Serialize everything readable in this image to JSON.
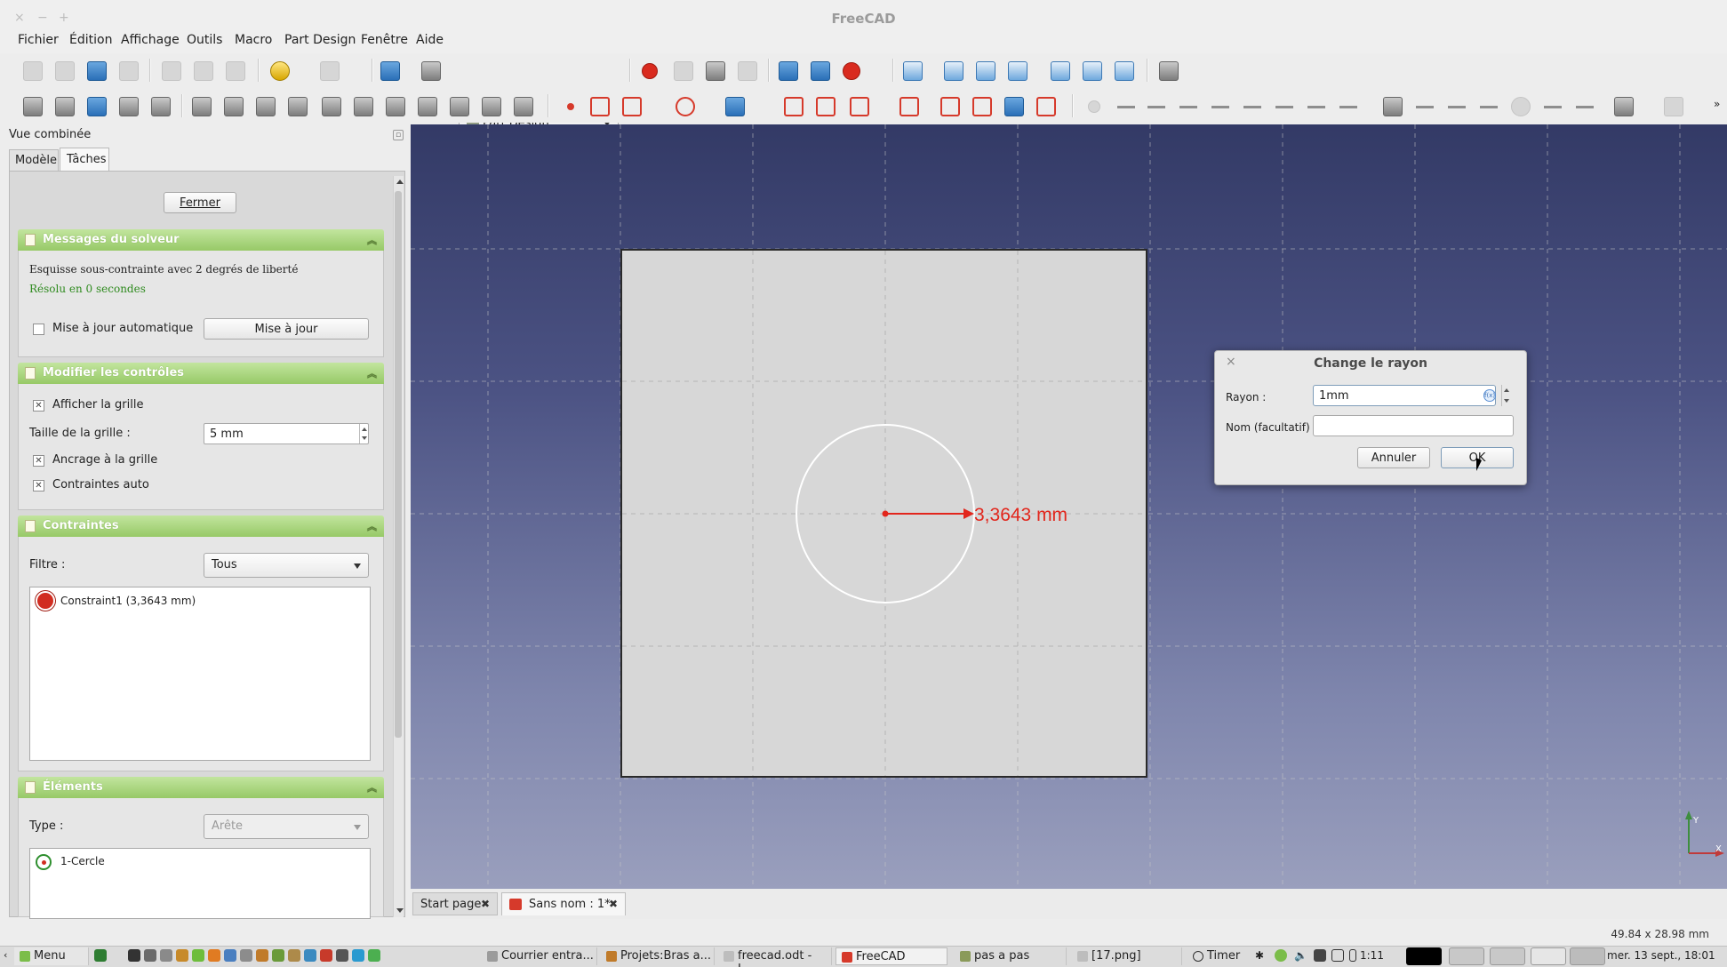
{
  "window": {
    "title": "FreeCAD",
    "controls": [
      "×",
      "−",
      "+"
    ]
  },
  "menu": [
    "Fichier",
    "Édition",
    "Affichage",
    "Outils",
    "Macro",
    "Part Design",
    "Fenêtre",
    "Aide"
  ],
  "workbench": {
    "selected": "Part Design"
  },
  "combo_view": {
    "title": "Vue combinée",
    "tabs": {
      "model": "Modèle",
      "tasks": "Tâches"
    },
    "close_button": "Fermer"
  },
  "solver": {
    "header": "Messages du solveur",
    "message": "Esquisse sous-contrainte avec 2 degrés de liberté",
    "solved": "Résolu en 0 secondes",
    "auto_update_label": "Mise à jour automatique",
    "auto_update_checked": false,
    "update_button": "Mise à jour"
  },
  "controls": {
    "header": "Modifier les contrôles",
    "show_grid": "Afficher la grille",
    "grid_size_label": "Taille de la grille :",
    "grid_size_value": "5 mm",
    "snap_grid": "Ancrage à la grille",
    "auto_constraints": "Contraintes auto",
    "show_grid_checked": true,
    "snap_checked": true,
    "auto_checked": true
  },
  "constraints": {
    "header": "Contraintes",
    "filter_label": "Filtre :",
    "filter_value": "Tous",
    "items": [
      "Constraint1 (3,3643 mm)"
    ]
  },
  "elements": {
    "header": "Éléments",
    "type_label": "Type :",
    "type_value": "Arête",
    "items": [
      "1-Cercle"
    ]
  },
  "viewport": {
    "dimension_label": "3,3643 mm",
    "axis_y": "Y",
    "axis_x": "X",
    "colors": {
      "dimension": "#e2261c",
      "sketch_bg": "#d7d7d7",
      "circle": "#ffffff"
    }
  },
  "view_tabs": [
    "Start page",
    "Sans nom : 1*"
  ],
  "status": {
    "dimensions": "49.84 x 28.98 mm"
  },
  "dialog": {
    "title": "Change le rayon",
    "close": "×",
    "radius_label": "Rayon :",
    "radius_value": "1mm",
    "name_label": "Nom (facultatif)",
    "name_value": "",
    "cancel_button": "Annuler",
    "ok_button": "OK"
  },
  "taskbar": {
    "menu": "Menu",
    "tasks": [
      "Courrier entra...",
      "Projets:Bras a...",
      "freecad.odt - L...",
      "FreeCAD",
      "pas a pas",
      "[17.png]"
    ],
    "timer": "Timer",
    "time_small": "1:11",
    "clock": "mer. 13 sept., 18:01"
  }
}
